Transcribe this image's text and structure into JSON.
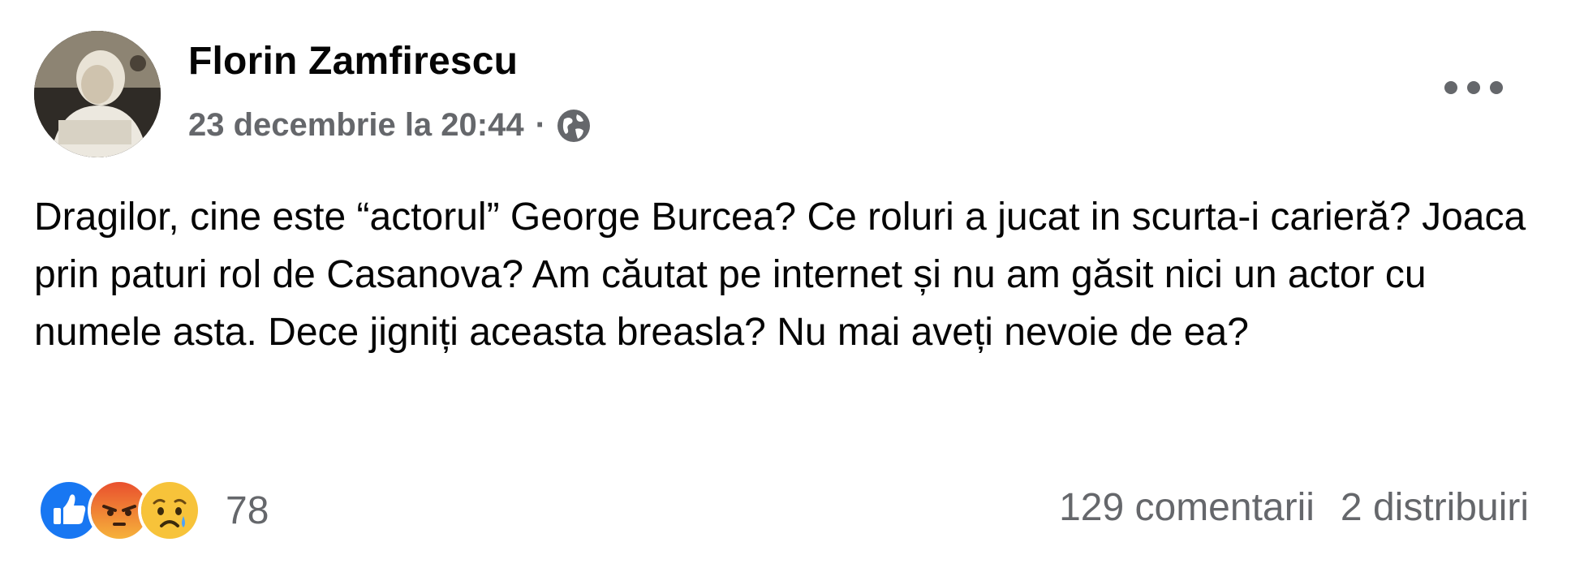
{
  "post": {
    "author": "Florin Zamfirescu",
    "timestamp": "23 decembrie la 20:44",
    "separator": "·",
    "privacy_icon": "globe-icon",
    "menu_icon": "more-options-icon",
    "text": "Dragilor, cine este “actorul” George Burcea? Ce roluri a jucat in scurta-i carieră? Joaca prin paturi rol de Casanova? Am căutat pe internet și nu am găsit nici un actor cu numele asta. Dece jigniți aceasta breasla? Nu mai aveți nevoie de ea?",
    "reactions": {
      "icons": [
        "like-icon",
        "angry-icon",
        "sad-icon"
      ],
      "count": "78"
    },
    "comments": "129 comentarii",
    "shares": "2 distribuiri"
  },
  "colors": {
    "like_blue": "#1877f2",
    "angry_orange": "#f0542f",
    "sad_yellow": "#f7c33a",
    "secondary_text": "#65676b"
  }
}
